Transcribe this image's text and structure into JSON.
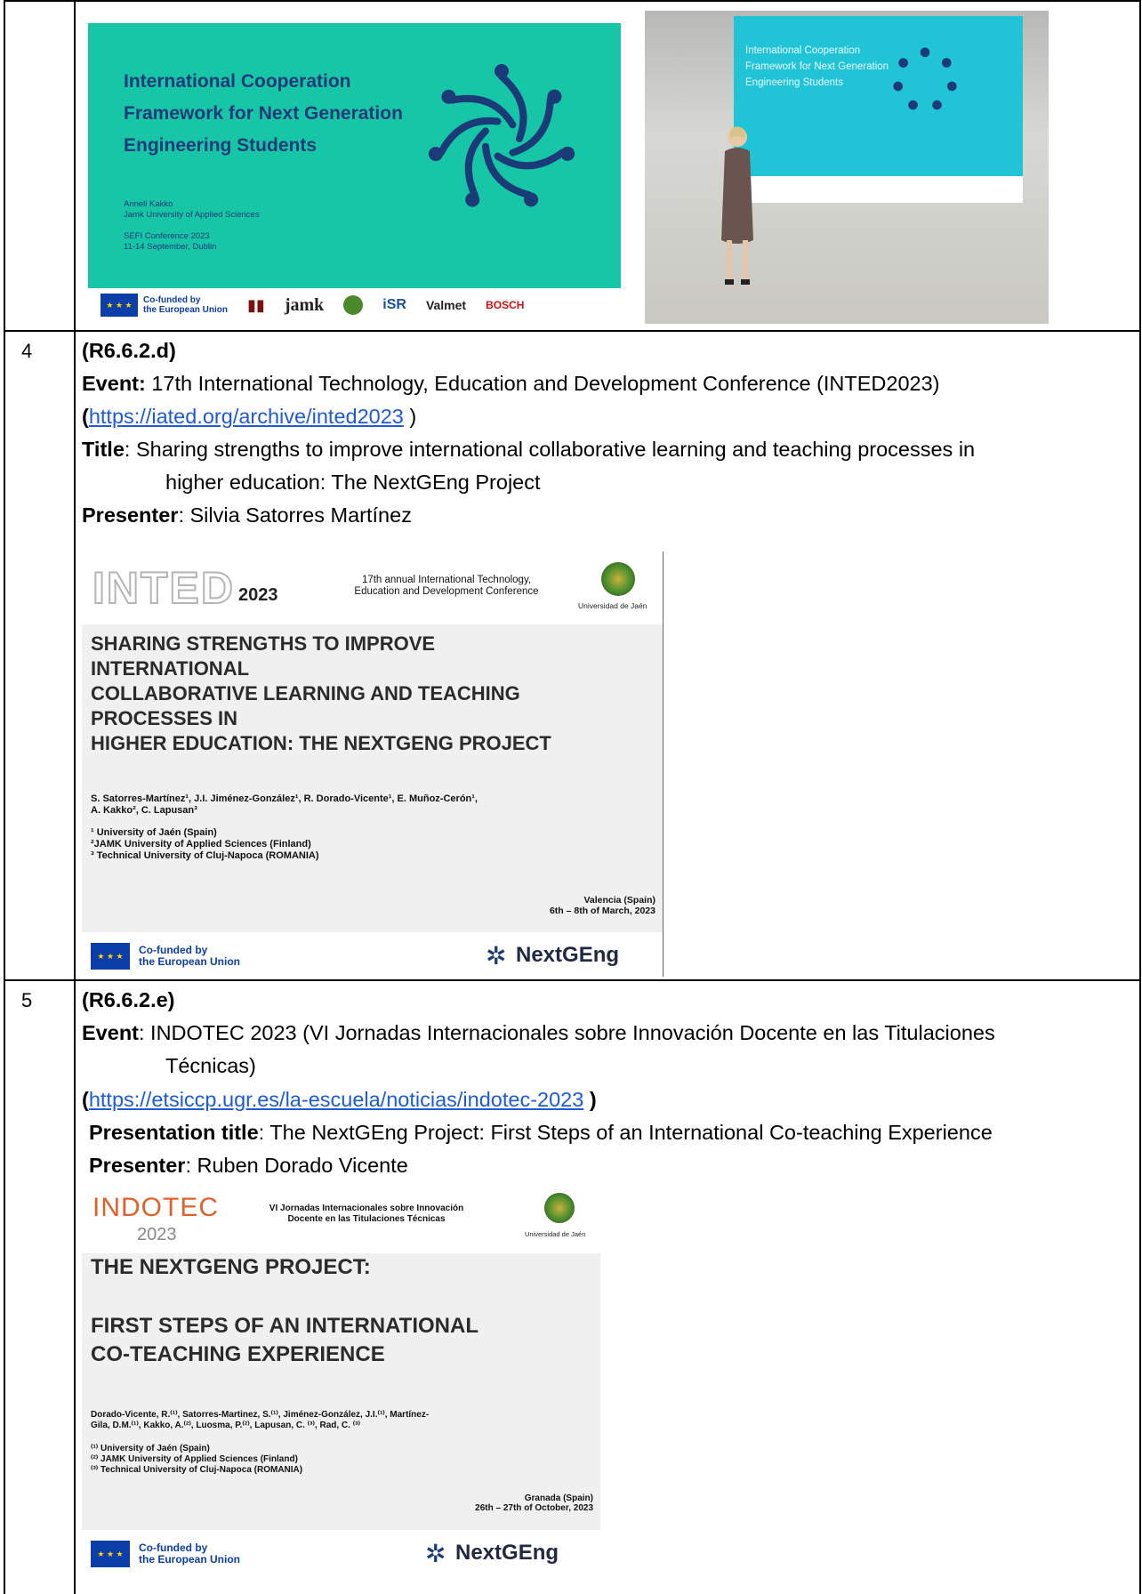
{
  "rows": [
    {
      "num": "4",
      "ref": "(R6.6.2.d)",
      "event_label": "Event:",
      "event_text": " 17th International Technology, Education and Development Conference (INTED2023)",
      "link_open": "(",
      "link": "https://iated.org/archive/inted2023",
      "link_close": " )",
      "title_label": "Title",
      "title_text1": ":  Sharing strengths to improve international collaborative learning and teaching processes in",
      "title_text2": "higher education: The NextGEng Project",
      "presenter_label": "Presenter",
      "presenter_text": ":  Silvia Satorres Martínez"
    },
    {
      "num": "5",
      "ref": "(R6.6.2.e)",
      "event_label": "Event",
      "event_text1": ":  INDOTEC 2023 (VI Jornadas Internacionales sobre Innovación Docente en las Titulaciones",
      "event_text2": "Técnicas)",
      "link_open": "(",
      "link": "https://etsiccp.ugr.es/la-escuela/noticias/indotec-2023",
      "link_close": " )",
      "title_label": "Presentation title",
      "title_text": ": The NextGEng Project: First Steps of an International Co-teaching Experience",
      "presenter_label": "Presenter",
      "presenter_text": ": Ruben Dorado Vicente"
    }
  ],
  "sefi_slide": {
    "title_lines": [
      "International Cooperation",
      "Framework for Next Generation",
      "Engineering Students"
    ],
    "author": "Anneli Kakko",
    "affiliation": "Jamk University of Applied Sciences",
    "conference": "SEFI Conference 2023",
    "dates": "11-14 September, Dublin",
    "eu_text_1": "Co-funded by",
    "eu_text_2": "the European Union",
    "logos": [
      "jamk",
      "iSR",
      "Valmet",
      "BOSCH"
    ]
  },
  "photo_screen": {
    "title_lines": [
      "International Cooperation",
      "Framework for Next Generation",
      "Engineering Students"
    ]
  },
  "inted_slide": {
    "brand": "INTED",
    "year": "2023",
    "conf_line1": "17th annual International Technology,",
    "conf_line2": "Education and Development Conference",
    "uni": "Universidad de Jaén",
    "title_lines": [
      "SHARING STRENGTHS TO IMPROVE",
      "INTERNATIONAL",
      "COLLABORATIVE LEARNING AND TEACHING",
      "PROCESSES IN",
      "HIGHER EDUCATION: THE NEXTGENG PROJECT"
    ],
    "authors_1": "S. Satorres-Martínez¹, J.I. Jiménez-González¹, R. Dorado-Vicente¹, E. Muñoz-Cerón¹,",
    "authors_2": "A. Kakko², C. Lapusan³",
    "aff_1": "¹ University of Jaén (Spain)",
    "aff_2": "²JAMK University of Applied Sciences (Finland)",
    "aff_3": "³ Technical University of Cluj-Napoca (ROMANIA)",
    "place": "Valencia (Spain)",
    "date": "6th – 8th of March, 2023",
    "eu_1": "Co-funded by",
    "eu_2": "the European Union",
    "project": "NextGEng"
  },
  "indotec_slide": {
    "brand": "INDOTEC",
    "year": "2023",
    "conf_line1": "VI Jornadas Internacionales sobre Innovación",
    "conf_line2": "Docente en las Titulaciones Técnicas",
    "uni": "Universidad de Jaén",
    "title_1": "THE NEXTGENG PROJECT:",
    "title_2": "FIRST STEPS OF AN INTERNATIONAL",
    "title_3": "CO-TEACHING EXPERIENCE",
    "authors_1": "Dorado-Vicente, R.⁽¹⁾, Satorres-Martinez, S.⁽¹⁾, Jiménez-González, J.I.⁽¹⁾, Martínez-",
    "authors_2": "Gila, D.M.⁽¹⁾, Kakko, A.⁽²⁾, Luosma, P.⁽²⁾, Lapusan, C. ⁽³⁾, Rad, C. ⁽³⁾",
    "aff_1": "⁽¹⁾ University of Jaén (Spain)",
    "aff_2": "⁽²⁾ JAMK University of Applied Sciences (Finland)",
    "aff_3": "⁽³⁾ Technical University of Cluj-Napoca (ROMANIA)",
    "place": "Granada (Spain)",
    "date": "26th – 27th of October, 2023",
    "eu_1": "Co-funded by",
    "eu_2": "the European Union",
    "project": "NextGEng"
  }
}
